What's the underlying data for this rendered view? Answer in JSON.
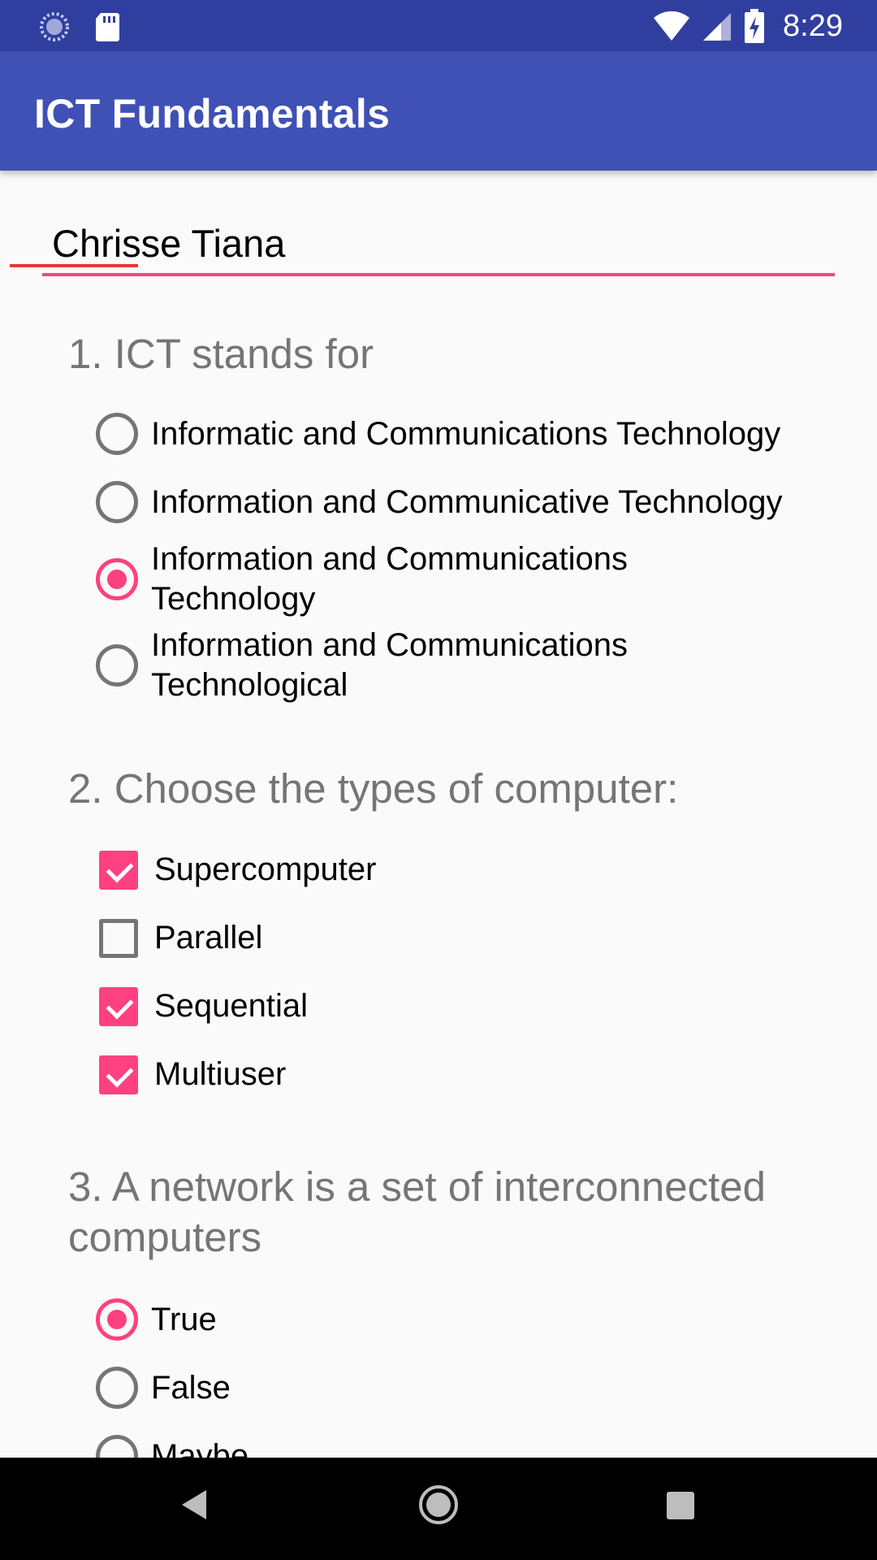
{
  "status_bar": {
    "time": "8:29",
    "icons": [
      "sync-icon",
      "sd-card-icon",
      "wifi-icon",
      "signal-icon",
      "battery-charging-icon"
    ]
  },
  "app_bar": {
    "title": "ICT Fundamentals"
  },
  "name_field": {
    "value": "Chrisse Tiana"
  },
  "questions": [
    {
      "title": "1. ICT stands for",
      "type": "radio",
      "options": [
        {
          "label": "Informatic and Communications Technology",
          "checked": false
        },
        {
          "label": "Information and Communicative Technology",
          "checked": false
        },
        {
          "label": "Information and Communications Technology",
          "checked": true
        },
        {
          "label": "Information and Communications Technological",
          "checked": false
        }
      ]
    },
    {
      "title": "2. Choose the types of computer:",
      "type": "checkbox",
      "options": [
        {
          "label": "Supercomputer",
          "checked": true
        },
        {
          "label": "Parallel",
          "checked": false
        },
        {
          "label": "Sequential",
          "checked": true
        },
        {
          "label": "Multiuser",
          "checked": true
        }
      ]
    },
    {
      "title": "3. A network is a set of interconnected computers",
      "type": "radio",
      "options": [
        {
          "label": "True",
          "checked": true
        },
        {
          "label": "False",
          "checked": false
        },
        {
          "label": "Maybe",
          "checked": false
        }
      ]
    }
  ],
  "nav_bar": {
    "icons": [
      "back-icon",
      "home-icon",
      "recents-icon"
    ]
  },
  "colors": {
    "primary": "#3f51b5",
    "primary_dark": "#303f9f",
    "accent": "#ff4081"
  }
}
